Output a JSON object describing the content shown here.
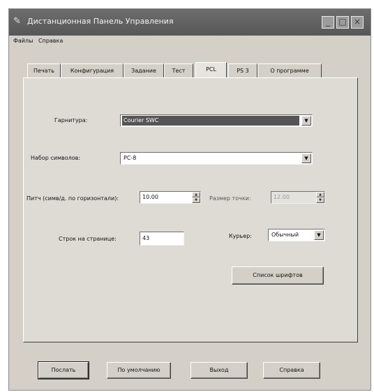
{
  "window": {
    "title": "Дистанционная Панель Управления",
    "icon": "printer-icon",
    "controls": [
      "minimize",
      "maximize",
      "close"
    ]
  },
  "menu": {
    "items": [
      "Файлы",
      "Справка"
    ]
  },
  "tabs": [
    {
      "label": "Печать",
      "active": false
    },
    {
      "label": "Конфигурация",
      "active": false
    },
    {
      "label": "Задание",
      "active": false
    },
    {
      "label": "Тест",
      "active": false
    },
    {
      "label": "PCL",
      "active": true
    },
    {
      "label": "PS 3",
      "active": false
    },
    {
      "label": "О программе",
      "active": false
    }
  ],
  "pcl": {
    "typeface_label": "Гарнитура:",
    "typeface_value": "Courier SWC",
    "symbol_set_label": "Набор символов:",
    "symbol_set_value": "PC-8",
    "pitch_label": "Питч (симв/д. по горизонтали):",
    "pitch_value": "10.00",
    "point_size_label": "Размер точки:",
    "point_size_value": "12.00",
    "lines_label": "Строк на странице:",
    "lines_value": "43",
    "courier_label": "Курьер:",
    "courier_value": "Обычный",
    "font_list_button": "Список шрифтов"
  },
  "footer": {
    "send_button": "Послать",
    "default_button": "По умолчанию",
    "exit_button": "Выход",
    "help_button": "Справка"
  },
  "colors": {
    "window_bg": "#d4d0c8",
    "titlebar": "#5f5f5f",
    "selection": "#555555"
  }
}
